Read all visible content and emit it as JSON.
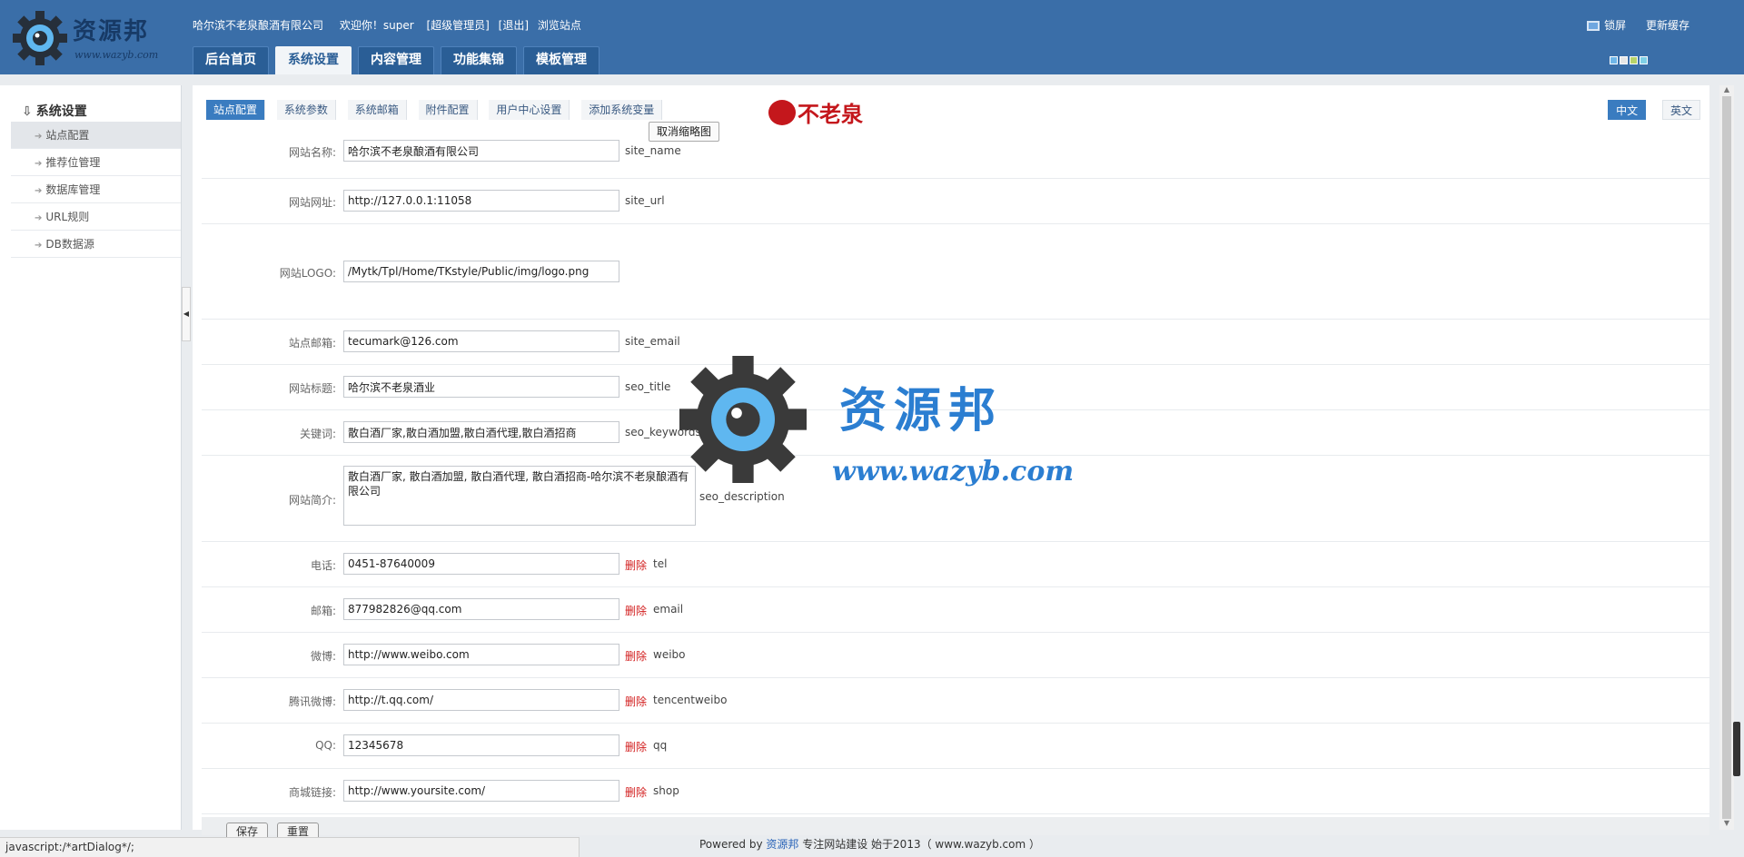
{
  "header": {
    "brand": "资源邦",
    "brand_url": "www.wazyb.com",
    "company": "哈尔滨不老泉酿酒有限公司",
    "welcome": "欢迎你！super",
    "role_link": "[超级管理员]",
    "logout_link": "[退出]",
    "browse_link": "浏览站点",
    "lock_label": "锁屏",
    "refresh_cache": "更新缓存",
    "tabs": [
      "后台首页",
      "系统设置",
      "内容管理",
      "功能集锦",
      "模板管理"
    ],
    "active_tab": "系统设置",
    "skin_colors": [
      "#6fb6e8",
      "#e6e6e6",
      "#b7d36a",
      "#7fd0e6"
    ]
  },
  "sidebar": {
    "title": "系统设置",
    "items": [
      "站点配置",
      "推荐位管理",
      "数据库管理",
      "URL规则",
      "DB数据源"
    ],
    "active": "站点配置"
  },
  "content": {
    "sub_tabs": [
      "站点配置",
      "系统参数",
      "系统邮箱",
      "附件配置",
      "用户中心设置",
      "添加系统变量"
    ],
    "site_logo_text": "不老泉",
    "cancel_thumb": "取消缩略图",
    "lang_tabs": [
      "中文",
      "英文"
    ]
  },
  "form": {
    "rows": [
      {
        "label": "网站名称:",
        "value": "哈尔滨不老泉酿酒有限公司",
        "key": "site_name"
      },
      {
        "label": "网站网址:",
        "value": "http://127.0.0.1:11058",
        "key": "site_url"
      },
      {
        "label": "网站LOGO:",
        "value": "/Mytk/Tpl/Home/TKstyle/Public/img/logo.png",
        "key": ""
      },
      {
        "label": "站点邮箱:",
        "value": "tecumark@126.com",
        "key": "site_email"
      },
      {
        "label": "网站标题:",
        "value": "哈尔滨不老泉酒业",
        "key": "seo_title"
      },
      {
        "label": "关键词:",
        "value": "散白酒厂家,散白酒加盟,散白酒代理,散白酒招商",
        "key": "seo_keywords"
      },
      {
        "label": "网站简介:",
        "value": "散白酒厂家, 散白酒加盟, 散白酒代理, 散白酒招商-哈尔滨不老泉酿酒有限公司",
        "key": "seo_description"
      },
      {
        "label": "电话:",
        "value": "0451-87640009",
        "key": "tel",
        "del": "删除"
      },
      {
        "label": "邮箱:",
        "value": "877982826@qq.com",
        "key": "email",
        "del": "删除"
      },
      {
        "label": "微博:",
        "value": "http://www.weibo.com",
        "key": "weibo",
        "del": "删除"
      },
      {
        "label": "腾讯微博:",
        "value": "http://t.qq.com/",
        "key": "tencentweibo",
        "del": "删除"
      },
      {
        "label": "QQ:",
        "value": "12345678",
        "key": "qq",
        "del": "删除"
      },
      {
        "label": "商城链接:",
        "value": "http://www.yoursite.com/",
        "key": "shop",
        "del": "删除"
      }
    ],
    "save_label": "保存",
    "reset_label": "重置"
  },
  "statusbar": {
    "text": "javascript:/*artDialog*/;"
  },
  "footer": {
    "powered_prefix": "Powered by",
    "powered_brand": "资源邦",
    "powered_suffix": "专注网站建设  始于2013（ www.wazyb.com ）"
  },
  "watermark": {
    "cn": "资源邦",
    "url": "www.wazyb.com"
  }
}
